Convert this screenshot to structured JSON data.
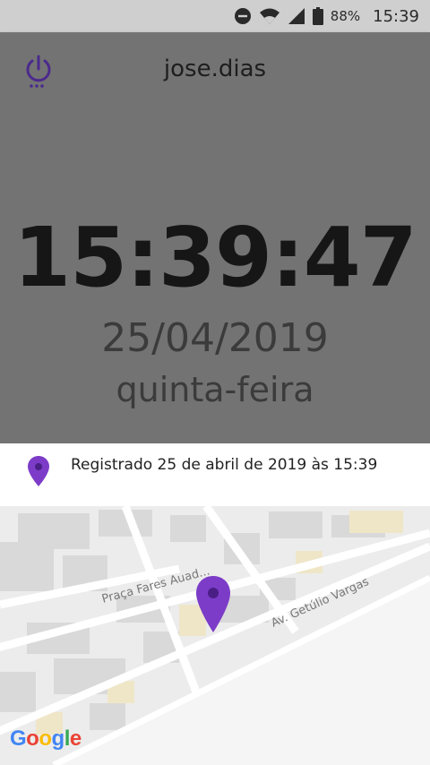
{
  "status_bar": {
    "battery_percent": "88%",
    "time": "15:39"
  },
  "app_bar": {
    "username": "jose.dias"
  },
  "clock": {
    "time": "15:39:47",
    "date": "25/04/2019",
    "weekday": "quinta-feira"
  },
  "registro": {
    "text": "Registrado 25 de abril de 2019 às 15:39"
  },
  "map": {
    "street_labels": [
      "Praça Fares Auad...",
      "Av. Getúlio Vargas"
    ],
    "logo_text": "Google",
    "marker_color": "#7c3cc8"
  },
  "colors": {
    "accent": "#7c3cc8",
    "panel": "#737373"
  }
}
